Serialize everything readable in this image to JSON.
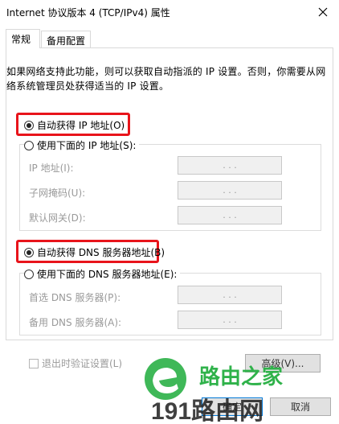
{
  "window": {
    "title": "Internet 协议版本 4 (TCP/IPv4) 属性"
  },
  "tabs": [
    {
      "label": "常规",
      "active": true
    },
    {
      "label": "备用配置",
      "active": false
    }
  ],
  "description": "如果网络支持此功能，则可以获取自动指派的 IP 设置。否则，你需要从网络系统管理员处获得适当的 IP 设置。",
  "ip": {
    "auto_label": "自动获得 IP 地址(O)",
    "auto_selected": true,
    "manual_label": "使用下面的 IP 地址(S):",
    "fields": [
      {
        "label": "IP 地址(I):",
        "value": ".   .   ."
      },
      {
        "label": "子网掩码(U):",
        "value": ".   .   ."
      },
      {
        "label": "默认网关(D):",
        "value": ".   .   ."
      }
    ]
  },
  "dns": {
    "auto_label": "自动获得 DNS 服务器地址(B)",
    "auto_selected": true,
    "manual_label": "使用下面的 DNS 服务器地址(E):",
    "fields": [
      {
        "label": "首选 DNS 服务器(P):",
        "value": ".   .   ."
      },
      {
        "label": "备用 DNS 服务器(A):",
        "value": ".   .   ."
      }
    ]
  },
  "validate_label": "退出时验证设置(L)",
  "advanced_label": "高级(V)...",
  "ok_label": "确定",
  "cancel_label": "取消",
  "watermark": {
    "line1": "路由之家",
    "line2": "191路由网"
  },
  "colors": {
    "highlight": "#e8141b",
    "watermark_green": "#2fb24a"
  }
}
